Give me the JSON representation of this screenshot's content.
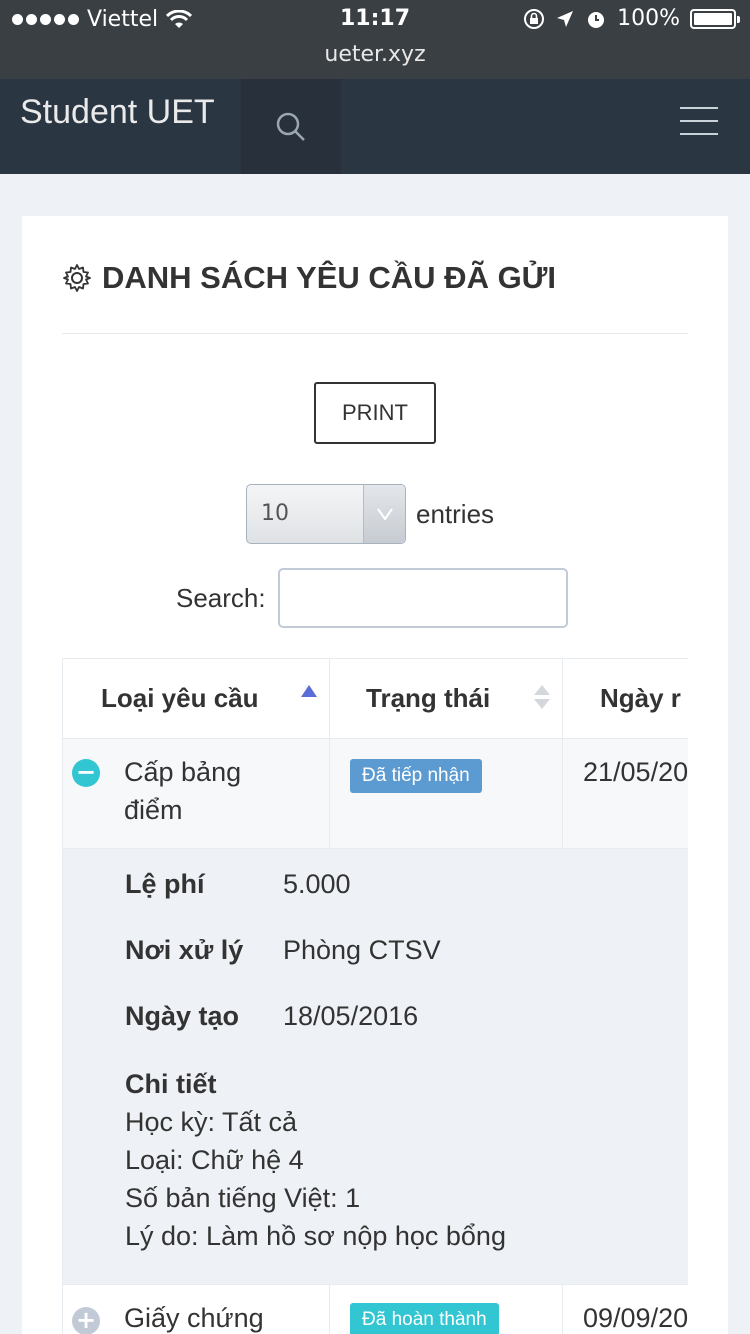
{
  "status_bar": {
    "carrier": "Viettel",
    "time": "11:17",
    "battery": "100%",
    "battery_level": 1.0
  },
  "browser": {
    "url": "ueter.xyz"
  },
  "nav": {
    "brand": "Student UET"
  },
  "card": {
    "title": "DANH SÁCH YÊU CẦU ĐÃ GỬI",
    "print_label": "PRINT",
    "length_select_value": "10",
    "entries_label": "entries",
    "search_label": "Search:",
    "search_value": ""
  },
  "table": {
    "headers": [
      "Loại yêu cầu",
      "Trạng thái",
      "Ngày r"
    ],
    "rows": [
      {
        "type_line1": "Cấp bảng",
        "type_line2": "điểm",
        "status": "Đã tiếp nhận",
        "date": "21/05/20",
        "expanded": true
      },
      {
        "type_line1": "Giấy chứng",
        "status": "Đã hoàn thành",
        "date": "09/09/20",
        "expanded": false
      }
    ],
    "detail": {
      "fee_label": "Lệ phí",
      "fee_value": "5.000",
      "place_label": "Nơi xử lý",
      "place_value": "Phòng CTSV",
      "created_label": "Ngày tạo",
      "created_value": "18/05/2016",
      "detail_label": "Chi tiết",
      "detail_lines": [
        "Học kỳ: Tất cả",
        "Loại: Chữ hệ 4",
        "Số bản tiếng Việt: 1",
        "Lý do: Làm hồ sơ nộp học bổng"
      ]
    }
  },
  "colors": {
    "nav_bg": "#2b3643",
    "badge_received": "#5c9bd1",
    "badge_done": "#32c5d2",
    "sort_active": "#5b6cd8"
  }
}
